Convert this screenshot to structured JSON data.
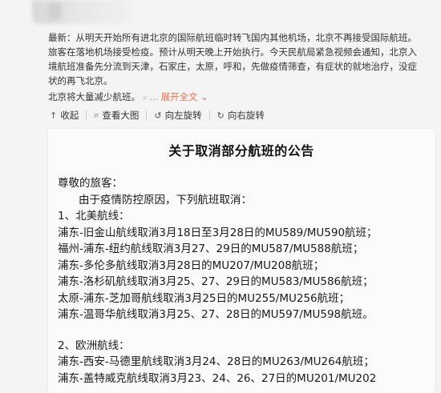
{
  "post": {
    "text": "最新：从明天开始所有进北京的国际航班临时转飞国内其他机场，北京不再接受国际航班。旅客在落地机场接受检疫。预计从明天晚上开始执行。今天民航局紧急视频会通知，北京入境航班准备先分流到天津，石家庄，太原，呼和，先做疫情筛查，有症状的就地治疗，没症状的再飞北京。",
    "tail": "北京将大量减少航班。",
    "ellipsis": "...",
    "expand_label": "展开全文",
    "expand_icon": "chevron-down-icon"
  },
  "toolbar": {
    "collapse_label": "收起",
    "view_large_label": "查看大图",
    "rotate_left_label": "向左旋转",
    "rotate_right_label": "向右旋转"
  },
  "notice": {
    "title": "关于取消部分航班的公告",
    "greeting": "尊敬的旅客：",
    "intro": "由于疫情防控原因，下列航班取消：",
    "sections": [
      {
        "heading": "1、北美航线：",
        "lines": [
          "浦东-旧金山航线取消3月18日至3月28日的MU589/MU590航班；",
          "福州-浦东-纽约航线取消3月27、29日的MU587/MU588航班；",
          "浦东-多伦多航线取消3月28日的MU207/MU208航班；",
          "浦东-洛杉矶航线取消3月25、27、29日的MU583/MU586航班；",
          "太原-浦东-芝加哥航线取消3月25日的MU255/MU256航班；",
          "浦东-温哥华航线取消3月25、27、28日的MU597/MU598航班。"
        ]
      },
      {
        "heading": "2、欧洲航线：",
        "lines": [
          "浦东-西安-马德里航线取消3月24、28日的MU263/MU264航班；",
          "浦东-盖特威克航线取消3月23、24、26、27日的MU201/MU202"
        ]
      }
    ]
  }
}
